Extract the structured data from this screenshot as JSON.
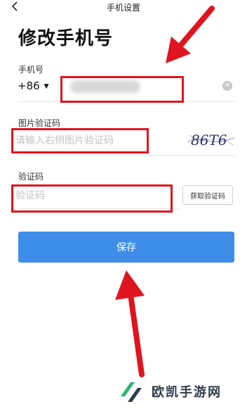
{
  "header": {
    "title": "手机设置"
  },
  "page_title": "修改手机号",
  "phone": {
    "label": "手机号",
    "country_code": "+86"
  },
  "image_captcha": {
    "label": "图片验证码",
    "placeholder": "请输入右侧图片验证码",
    "captcha_text": "86T6"
  },
  "sms_code": {
    "label": "验证码",
    "placeholder": "验证码",
    "get_code_label": "获取验证码"
  },
  "save_label": "保存",
  "watermark": {
    "text": "欧凯手游网"
  },
  "colors": {
    "primary": "#3e8ee9",
    "annotation": "#e0141f"
  }
}
